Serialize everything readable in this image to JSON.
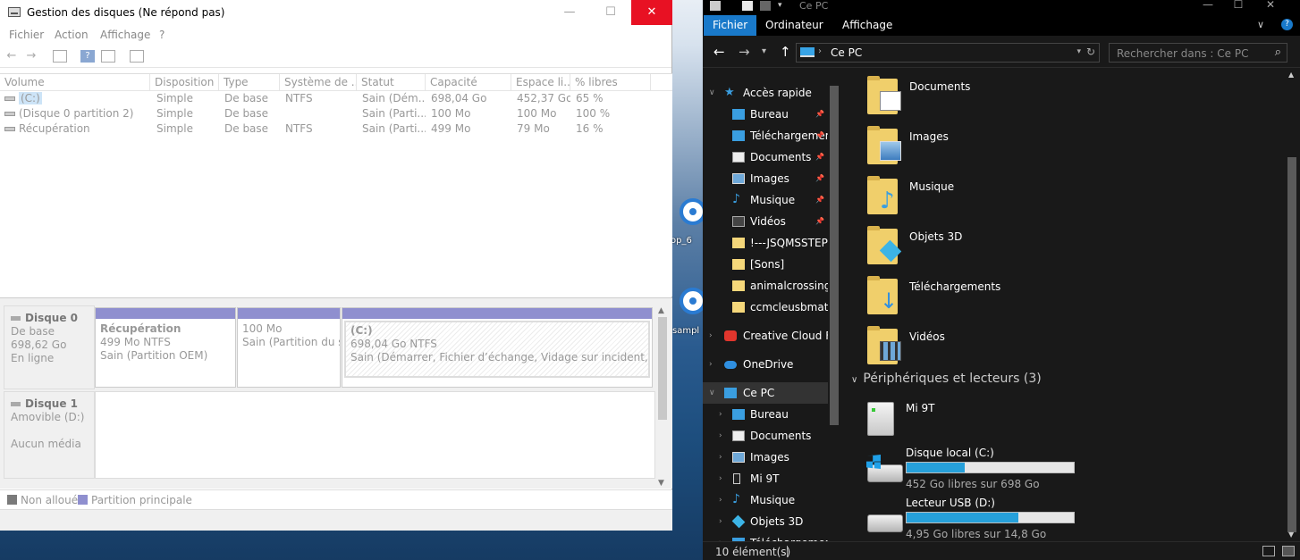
{
  "desktop": {
    "icon_labels": [
      "op_6",
      "sampl"
    ]
  },
  "disk_management": {
    "title": "Gestion des disques (Ne répond pas)",
    "window_buttons": {
      "minimize": "—",
      "maximize": "☐",
      "close": "✕"
    },
    "menu": [
      "Fichier",
      "Action",
      "Affichage",
      "?"
    ],
    "toolbar": {
      "back": "←",
      "forward": "→",
      "help": "?"
    },
    "columns": [
      "Volume",
      "Disposition",
      "Type",
      "Système de ...",
      "Statut",
      "Capacité",
      "Espace li...",
      "% libres"
    ],
    "rows": [
      {
        "volume": "(C:)",
        "disposition": "Simple",
        "type": "De base",
        "fs": "NTFS",
        "status": "Sain (Dém...",
        "capacity": "698,04 Go",
        "free": "452,37 Go",
        "pct": "65 %"
      },
      {
        "volume": "(Disque 0 partition 2)",
        "disposition": "Simple",
        "type": "De base",
        "fs": "",
        "status": "Sain (Parti...",
        "capacity": "100 Mo",
        "free": "100 Mo",
        "pct": "100 %"
      },
      {
        "volume": "Récupération",
        "disposition": "Simple",
        "type": "De base",
        "fs": "NTFS",
        "status": "Sain (Parti...",
        "capacity": "499 Mo",
        "free": "79 Mo",
        "pct": "16 %"
      }
    ],
    "disk0": {
      "name": "Disque 0",
      "type": "De base",
      "size": "698,62 Go",
      "state": "En ligne",
      "partitions": [
        {
          "name": "Récupération",
          "size": "499 Mo NTFS",
          "status": "Sain (Partition OEM)"
        },
        {
          "name": "",
          "size": "100 Mo",
          "status": "Sain (Partition du sy"
        },
        {
          "name": "(C:)",
          "size": "698,04 Go NTFS",
          "status": "Sain (Démarrer, Fichier d’échange, Vidage sur incident, Partitior"
        }
      ]
    },
    "disk1": {
      "name": "Disque 1",
      "type": "Amovible (D:)",
      "media": "Aucun média"
    },
    "legend": {
      "unallocated": "Non alloué",
      "primary": "Partition principale",
      "unallocated_color": "#7a7a7a",
      "primary_color": "#8f8fcf"
    }
  },
  "explorer": {
    "title": "Ce PC",
    "window_buttons": {
      "minimize": "—",
      "maximize": "☐",
      "close": "✕"
    },
    "ribbon_tabs": [
      "Fichier",
      "Ordinateur",
      "Affichage"
    ],
    "ribbon_chevron": "∨",
    "ribbon_help": "?",
    "address": "Ce PC",
    "search_placeholder": "Rechercher dans : Ce PC",
    "nav_items": [
      {
        "label": "Accès rapide",
        "icon": "star-icon",
        "pinned": false
      },
      {
        "label": "Bureau",
        "icon": "desktop-icon",
        "pinned": true
      },
      {
        "label": "Téléchargements",
        "icon": "download-icon",
        "pinned": true
      },
      {
        "label": "Documents",
        "icon": "document-icon",
        "pinned": true
      },
      {
        "label": "Images",
        "icon": "image-icon",
        "pinned": true
      },
      {
        "label": "Musique",
        "icon": "music-icon",
        "pinned": true
      },
      {
        "label": "Vidéos",
        "icon": "video-icon",
        "pinned": true
      },
      {
        "label": "!---JSQMSSTEP-",
        "icon": "folder-icon",
        "pinned": false
      },
      {
        "label": "[Sons]",
        "icon": "folder-icon",
        "pinned": false
      },
      {
        "label": "animalcrossing",
        "icon": "folder-icon",
        "pinned": false
      },
      {
        "label": "ccmcleusbmath",
        "icon": "folder-icon",
        "pinned": false
      },
      {
        "label": "Creative Cloud Fil",
        "icon": "creative-cloud-icon",
        "pinned": false
      },
      {
        "label": "OneDrive",
        "icon": "cloud-icon",
        "pinned": false
      },
      {
        "label": "Ce PC",
        "icon": "computer-icon",
        "pinned": false
      },
      {
        "label": "Bureau",
        "icon": "desktop-icon",
        "pinned": false
      },
      {
        "label": "Documents",
        "icon": "document-icon",
        "pinned": false
      },
      {
        "label": "Images",
        "icon": "image-icon",
        "pinned": false
      },
      {
        "label": "Mi 9T",
        "icon": "phone-icon",
        "pinned": false
      },
      {
        "label": "Musique",
        "icon": "music-icon",
        "pinned": false
      },
      {
        "label": "Objets 3D",
        "icon": "cube-icon",
        "pinned": false
      },
      {
        "label": "Téléchargements",
        "icon": "download-icon",
        "pinned": false
      }
    ],
    "folders": [
      {
        "label": "Documents",
        "overlay": "document-icon"
      },
      {
        "label": "Images",
        "overlay": "image-icon"
      },
      {
        "label": "Musique",
        "overlay": "music-icon"
      },
      {
        "label": "Objets 3D",
        "overlay": "cube-icon"
      },
      {
        "label": "Téléchargements",
        "overlay": "download-icon"
      },
      {
        "label": "Vidéos",
        "overlay": "video-icon"
      }
    ],
    "devices_header": "Périphériques et lecteurs (3)",
    "devices": [
      {
        "name": "Mi 9T",
        "icon": "phone-icon"
      },
      {
        "name": "Disque local (C:)",
        "icon": "hard-drive-icon",
        "free": "452 Go libres sur 698 Go",
        "used_fraction": 0.35
      },
      {
        "name": "Lecteur USB (D:)",
        "icon": "usb-drive-icon",
        "free": "4,95 Go libres sur 14,8 Go",
        "used_fraction": 0.67
      }
    ],
    "status": "10 élément(s)",
    "accent": "#1979ca",
    "bar_color": "#26a0da"
  }
}
